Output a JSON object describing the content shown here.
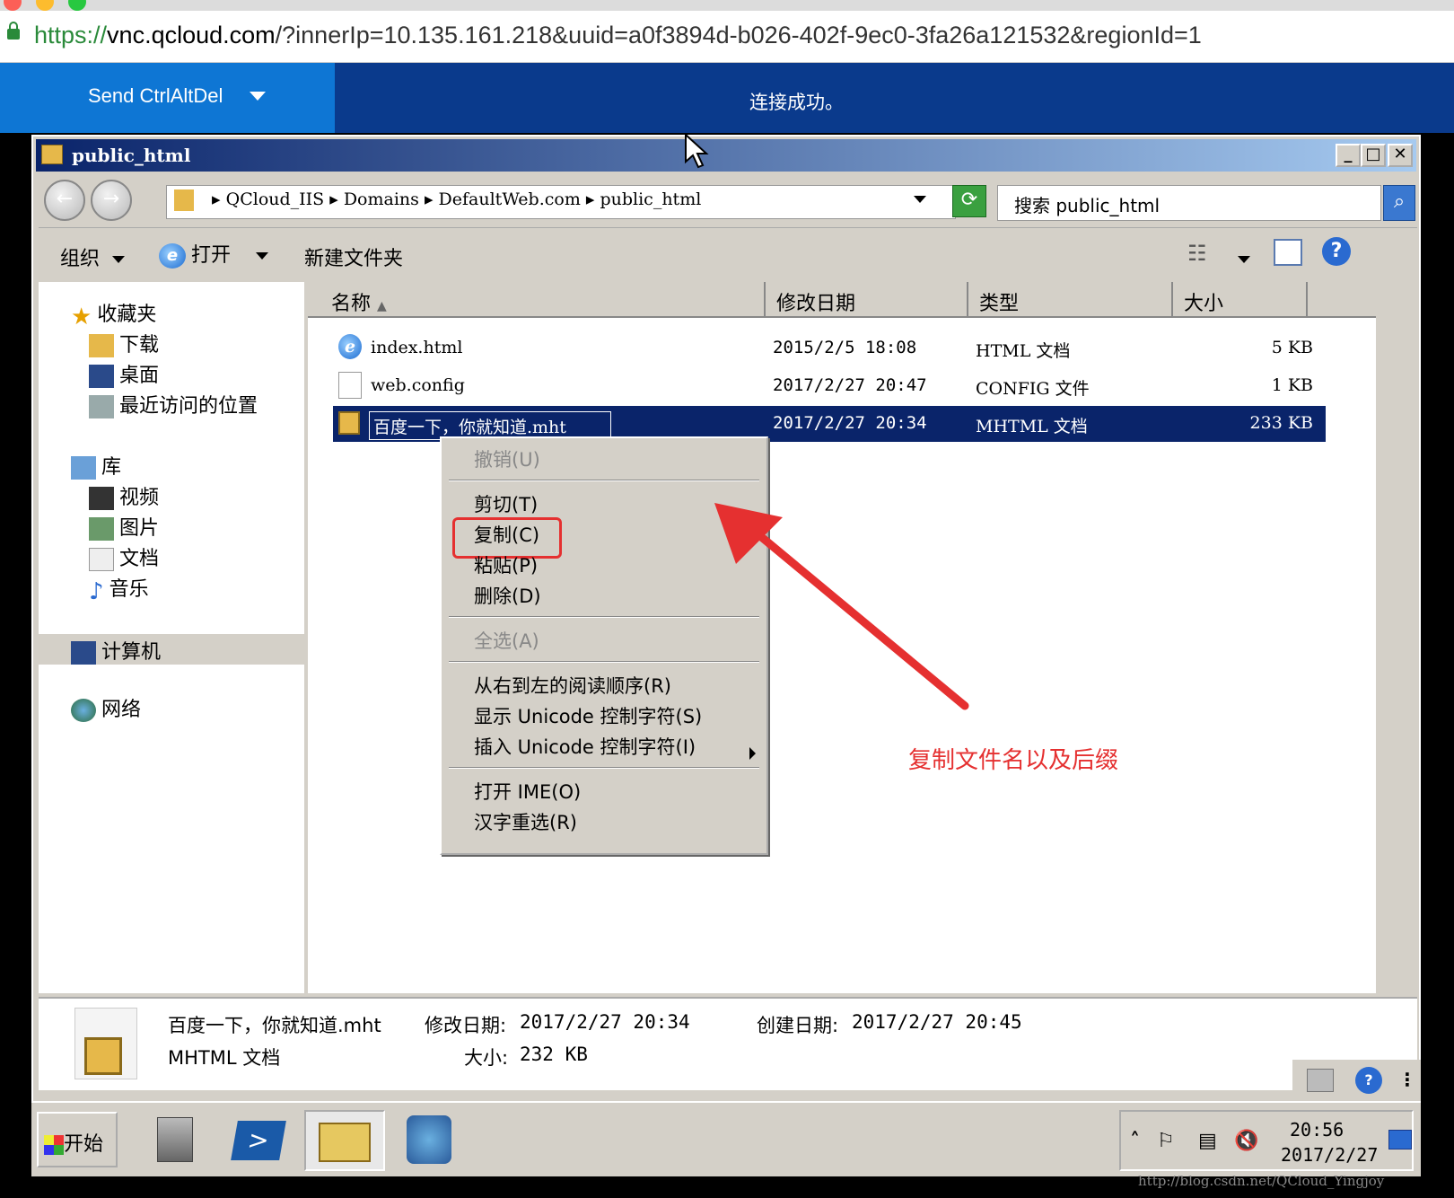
{
  "browser": {
    "url_scheme": "https://",
    "url_host": "vnc.qcloud.com",
    "url_path": "/?innerIp=10.135.161.218&uuid=a0f3894d-b026-402f-9ec0-3fa26a121532&regionId=1"
  },
  "vnc": {
    "send_ctrl_label": "Send CtrlAltDel",
    "status": "连接成功。"
  },
  "window": {
    "title": "public_html",
    "minimize": "_",
    "maximize": "□",
    "close": "✕"
  },
  "nav": {
    "breadcrumb": [
      "QCloud_IIS",
      "Domains",
      "DefaultWeb.com",
      "public_html"
    ],
    "search_placeholder": "搜索 public_html"
  },
  "toolbar": {
    "organize": "组织",
    "open": "打开",
    "new_folder": "新建文件夹"
  },
  "sidebar": {
    "favorites": "收藏夹",
    "downloads": "下载",
    "desktop": "桌面",
    "recent": "最近访问的位置",
    "libraries": "库",
    "videos": "视频",
    "pictures": "图片",
    "documents": "文档",
    "music": "音乐",
    "computer": "计算机",
    "network": "网络"
  },
  "columns": {
    "name": "名称",
    "modified": "修改日期",
    "type": "类型",
    "size": "大小"
  },
  "files": [
    {
      "name": "index.html",
      "modified": "2015/2/5 18:08",
      "type": "HTML 文档",
      "size": "5 KB"
    },
    {
      "name": "web.config",
      "modified": "2017/2/27 20:47",
      "type": "CONFIG 文件",
      "size": "1 KB"
    },
    {
      "name": "百度一下，你就知道.mht",
      "modified": "2017/2/27 20:34",
      "type": "MHTML 文档",
      "size": "233 KB"
    }
  ],
  "context_menu": {
    "undo": "撤销(U)",
    "cut": "剪切(T)",
    "copy": "复制(C)",
    "paste": "粘贴(P)",
    "delete": "删除(D)",
    "select_all": "全选(A)",
    "rtl": "从右到左的阅读顺序(R)",
    "show_unicode": "显示 Unicode 控制字符(S)",
    "insert_unicode": "插入 Unicode 控制字符(I)",
    "open_ime": "打开 IME(O)",
    "reconvert": "汉字重选(R)"
  },
  "annotation": "复制文件名以及后缀",
  "details": {
    "filename": "百度一下，你就知道.mht",
    "modified_label": "修改日期:",
    "modified_value": "2017/2/27 20:34",
    "created_label": "创建日期:",
    "created_value": "2017/2/27 20:45",
    "type": "MHTML 文档",
    "size_label": "大小:",
    "size_value": "232 KB"
  },
  "taskbar": {
    "start": "开始",
    "time": "20:56",
    "date": "2017/2/27"
  },
  "watermark": "http://blog.csdn.net/QCloud_Yingjoy",
  "colors": {
    "vnc_bar": "#0a3a8c",
    "send_button": "#0e76d4",
    "selection": "#0a246a",
    "annotation_red": "#e53030"
  }
}
